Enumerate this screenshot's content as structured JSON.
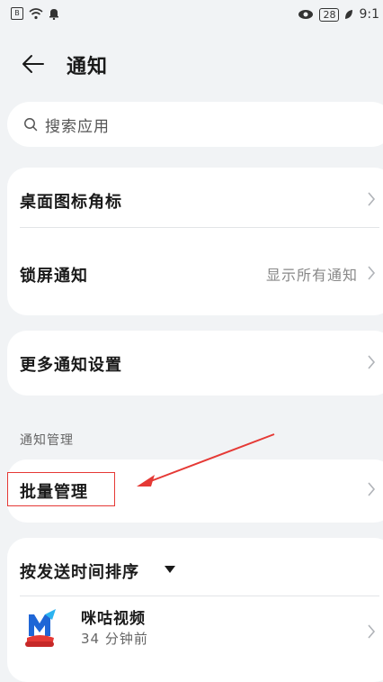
{
  "status_bar": {
    "time": "9:1",
    "battery": "28"
  },
  "header": {
    "title": "通知"
  },
  "search": {
    "placeholder": "搜索应用"
  },
  "card1": {
    "badge_label": "桌面图标角标",
    "lockscreen_label": "锁屏通知",
    "lockscreen_value": "显示所有通知"
  },
  "card2": {
    "more_label": "更多通知设置"
  },
  "section": {
    "title": "通知管理"
  },
  "batch": {
    "label": "批量管理"
  },
  "sort": {
    "label": "按发送时间排序"
  },
  "apps": [
    {
      "name": "咪咕视频",
      "time": "34 分钟前",
      "icon": "migu-video-app-icon"
    }
  ],
  "colors": {
    "background": "#f1f3f5",
    "card": "#ffffff",
    "annotation": "#e53935",
    "chevron": "#b0b3b8"
  }
}
